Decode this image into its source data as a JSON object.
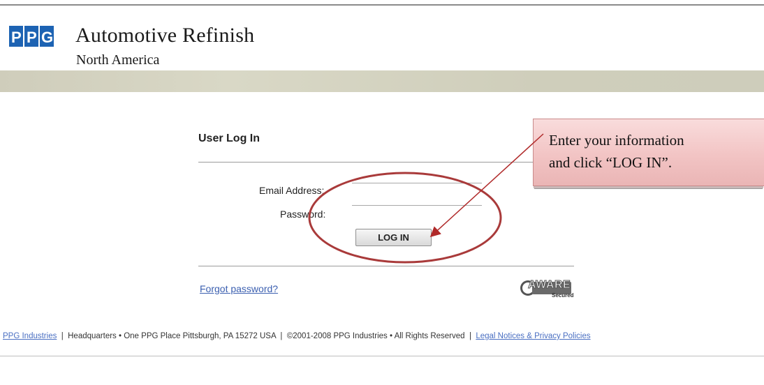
{
  "brand": {
    "logo_text": "PPG",
    "title": "Automotive Refinish",
    "subtitle": "North America",
    "logo_color": "#1d63b3",
    "band_color": "#d2d1bf"
  },
  "login": {
    "title": "User Log In",
    "email_label": "Email Address:",
    "email_value": "",
    "password_label": "Password:",
    "password_value": "",
    "button_label": "LOG IN",
    "forgot_link": "Forgot password?"
  },
  "badge": {
    "text": "AWARE",
    "subtext": "Secured",
    "icon": "aware-secured-badge"
  },
  "footer": {
    "link_company": "PPG Industries",
    "separator": "|",
    "headquarters": "Headquarters • One PPG Place Pittsburgh, PA 15272 USA",
    "copyright": "©2001-2008 PPG Industries • All Rights Reserved",
    "link_legal": "Legal Notices & Privacy Policies"
  },
  "callout": {
    "line1": "Enter your information",
    "line2": "and click “LOG IN”.",
    "fill_color": "#f2c4c4",
    "annotation_color": "#b02a2a"
  }
}
